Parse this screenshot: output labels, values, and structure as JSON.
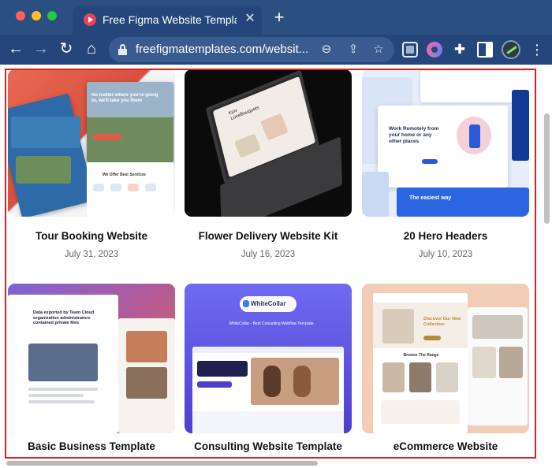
{
  "browser": {
    "tab_title": "Free Figma Website Templates",
    "tab_close": "✕",
    "new_tab": "+",
    "url": "freefigmatemplates.com/websit...",
    "nav": {
      "back": "←",
      "forward": "→",
      "reload": "↻",
      "home": "⌂"
    },
    "omnibox_icons": {
      "zoom": "⊖",
      "share": "⇪",
      "star": "☆"
    },
    "menu": "⋮",
    "extensions": [
      "screenshot-extension-icon",
      "color-wheel-extension-icon",
      "puzzle-icon",
      "sidebar-icon"
    ]
  },
  "templates": [
    {
      "title": "Tour Booking Website",
      "date": "July 31, 2023",
      "thumb_text": "No matter where you're going to, we'll take you there",
      "thumb_sub": "We Offer Best Services",
      "thumb_color": "#e2634d"
    },
    {
      "title": "Flower Delivery Website Kit",
      "date": "July 16, 2023",
      "thumb_text": "Kyiv LuxeBouquets",
      "thumb_color": "#0c0c0c"
    },
    {
      "title": "20 Hero Headers",
      "date": "July 10, 2023",
      "thumb_text": "Work Remotely from your home or any other places",
      "thumb_sub": "The easiest way",
      "thumb_color": "#e8eefb"
    },
    {
      "title": "Basic Business Template",
      "date": "",
      "thumb_text": "Data exported by Team Cloud organization administrators contained private files",
      "thumb_color": "#8b5cc6"
    },
    {
      "title": "Consulting Website Template",
      "date": "",
      "thumb_text": "WhiteCollar",
      "thumb_sub": "WhiteCollar - Best Consulting Webflow Template",
      "thumb_color": "#5a4bd6"
    },
    {
      "title": "eCommerce Website",
      "date": "",
      "thumb_text": "Discover Our New Collection",
      "thumb_sub": "Browse The Range",
      "thumb_color": "#f0c9b4"
    }
  ]
}
